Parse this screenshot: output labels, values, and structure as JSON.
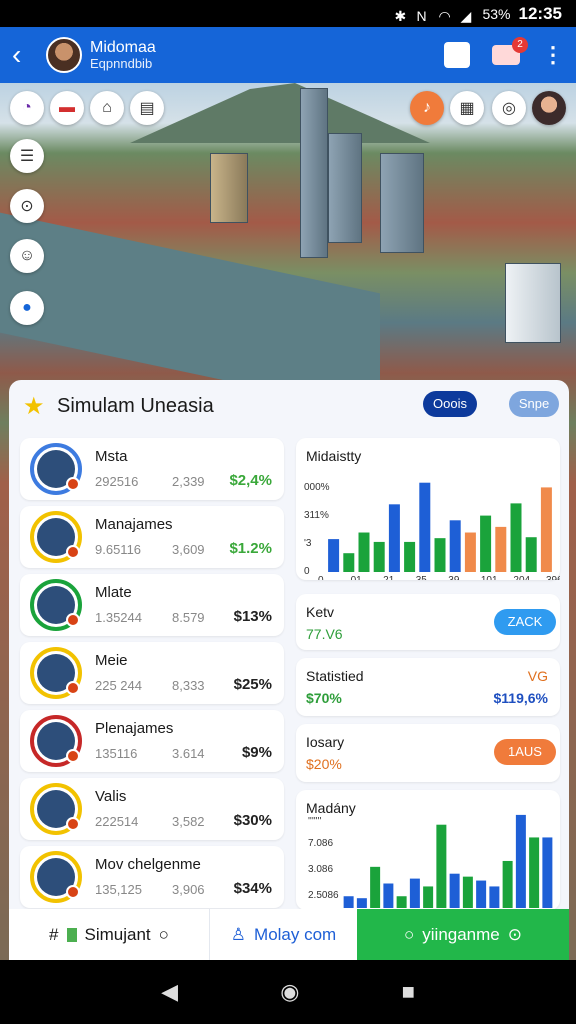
{
  "status": {
    "battery": "53%",
    "time": "12:35"
  },
  "header": {
    "title": "Midomaa",
    "subtitle": "Eqpnndbib",
    "notification_count": "2"
  },
  "scene": {
    "name": "city-aerial-view"
  },
  "sheet": {
    "title": "Simulam Uneasia",
    "pill_primary": "Ooois",
    "pill_secondary": "Snpe",
    "items": [
      {
        "name": "Msta",
        "n1": "292516",
        "n2": "2,339",
        "value": "$2,4%",
        "value_color": "#3aa83a",
        "ring": "#3d7be0"
      },
      {
        "name": "Manajames",
        "n1": "9.65116",
        "n2": "3,609",
        "value": "$1.2%",
        "value_color": "#3aa83a",
        "ring": "#f2c200"
      },
      {
        "name": "Mlate",
        "n1": "1.35244",
        "n2": "8.579",
        "value": "$13%",
        "value_color": "#222",
        "ring": "#1aa33b"
      },
      {
        "name": "Meie",
        "n1": "225 244",
        "n2": "8,333",
        "value": "$25%",
        "value_color": "#222",
        "ring": "#f2c200"
      },
      {
        "name": "Plenajames",
        "n1": "135116",
        "n2": "3.614",
        "value": "$9%",
        "value_color": "#222",
        "ring": "#c62828"
      },
      {
        "name": "Valis",
        "n1": "222514",
        "n2": "3,582",
        "value": "$30%",
        "value_color": "#222",
        "ring": "#f2c200"
      },
      {
        "name": "Mov chelgenme",
        "n1": "135,125",
        "n2": "3,906",
        "value": "$34%",
        "value_color": "#222",
        "ring": "#f2c200"
      }
    ],
    "card_chart1": {
      "title": "Midaistty"
    },
    "card_kety": {
      "title": "Ketv",
      "value": "77.V6",
      "button": "ZACK"
    },
    "card_stats": {
      "title": "Statistied",
      "tag": "VG",
      "value_left": "$70%",
      "value_right": "$119,6%"
    },
    "card_iosary": {
      "title": "Iosary",
      "value": "$20%",
      "button": "1AUS"
    },
    "card_chart2": {
      "title": "Madány"
    }
  },
  "chart_data": [
    {
      "type": "bar",
      "title": "Midaistty",
      "yticks": [
        "000%",
        "311%",
        "'3",
        "0"
      ],
      "xticks": [
        "0",
        "01",
        "21",
        "35",
        "39",
        "101",
        "204",
        "396"
      ],
      "values": [
        35,
        20,
        42,
        32,
        72,
        32,
        95,
        36,
        55,
        42,
        60,
        48,
        73,
        37,
        90
      ],
      "colors": [
        "#1e5fd6",
        "#1aa33b",
        "#1aa33b",
        "#1aa33b",
        "#1e5fd6",
        "#1aa33b",
        "#1e5fd6",
        "#1aa33b",
        "#1e5fd6",
        "#f08a4b",
        "#1aa33b",
        "#f08a4b",
        "#1aa33b",
        "#1aa33b",
        "#f08a4b"
      ],
      "ylim": [
        0,
        100
      ]
    },
    {
      "type": "bar",
      "title": "Madány",
      "yticks": [
        "'''''''",
        "7.086",
        "3.086",
        "2.5086"
      ],
      "values": [
        12,
        10,
        42,
        25,
        12,
        30,
        22,
        85,
        35,
        32,
        28,
        22,
        48,
        95,
        72,
        72
      ],
      "colors": [
        "#1e5fd6",
        "#1e5fd6",
        "#1aa33b",
        "#1e5fd6",
        "#1aa33b",
        "#1e5fd6",
        "#1aa33b",
        "#1aa33b",
        "#1e5fd6",
        "#1aa33b",
        "#1e5fd6",
        "#1e5fd6",
        "#1aa33b",
        "#1e5fd6",
        "#1aa33b",
        "#1e5fd6"
      ],
      "ylim": [
        0,
        100
      ]
    }
  ],
  "bottom": {
    "tab1": "Simujant",
    "tab2": "Molay com",
    "tab3": "yiinganme"
  }
}
